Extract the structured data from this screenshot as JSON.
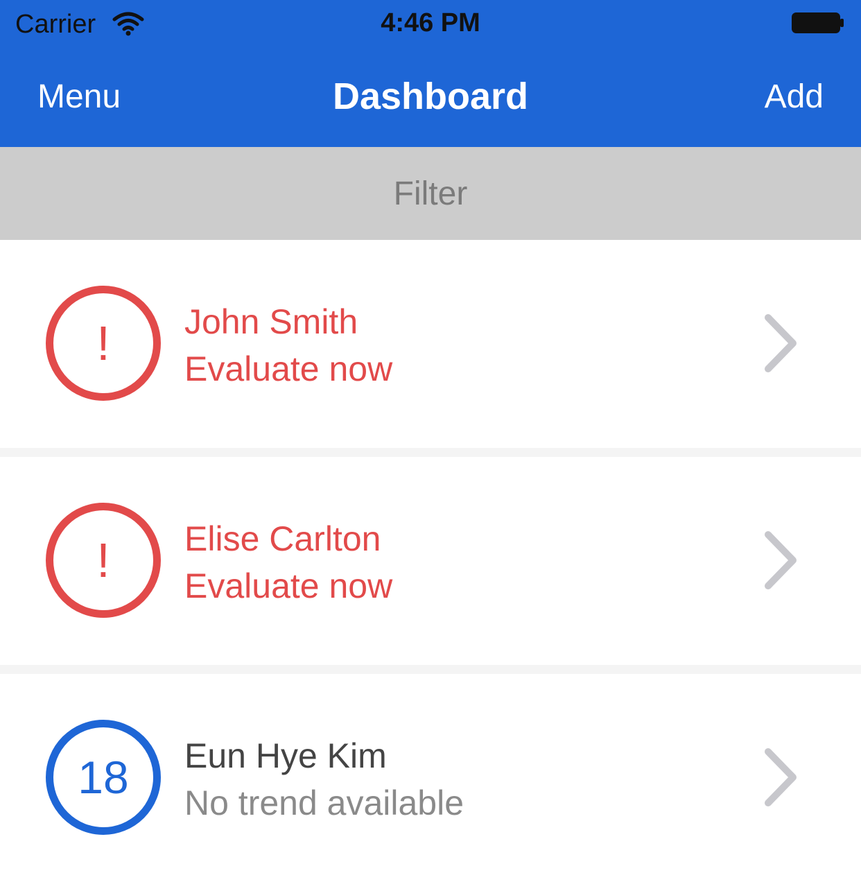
{
  "status_bar": {
    "carrier": "Carrier",
    "time": "4:46 PM",
    "wifi_icon": "wifi-icon",
    "battery_icon": "battery-icon"
  },
  "navbar": {
    "left_label": "Menu",
    "title": "Dashboard",
    "right_label": "Add",
    "background_color": "#1e66d6"
  },
  "filter": {
    "label": "Filter"
  },
  "patients": [
    {
      "badge": "!",
      "name": "John Smith",
      "status": "Evaluate now",
      "alert": true,
      "chevron_icon": "chevron-right-icon"
    },
    {
      "badge": "!",
      "name": "Elise Carlton",
      "status": "Evaluate now",
      "alert": true,
      "chevron_icon": "chevron-right-icon"
    },
    {
      "badge": "18",
      "name": "Eun Hye Kim",
      "status": "No trend available",
      "alert": false,
      "chevron_icon": "chevron-right-icon"
    }
  ],
  "colors": {
    "alert": "#e24a4a",
    "accent": "#1e66d6",
    "filter_bar": "#cccccc"
  }
}
